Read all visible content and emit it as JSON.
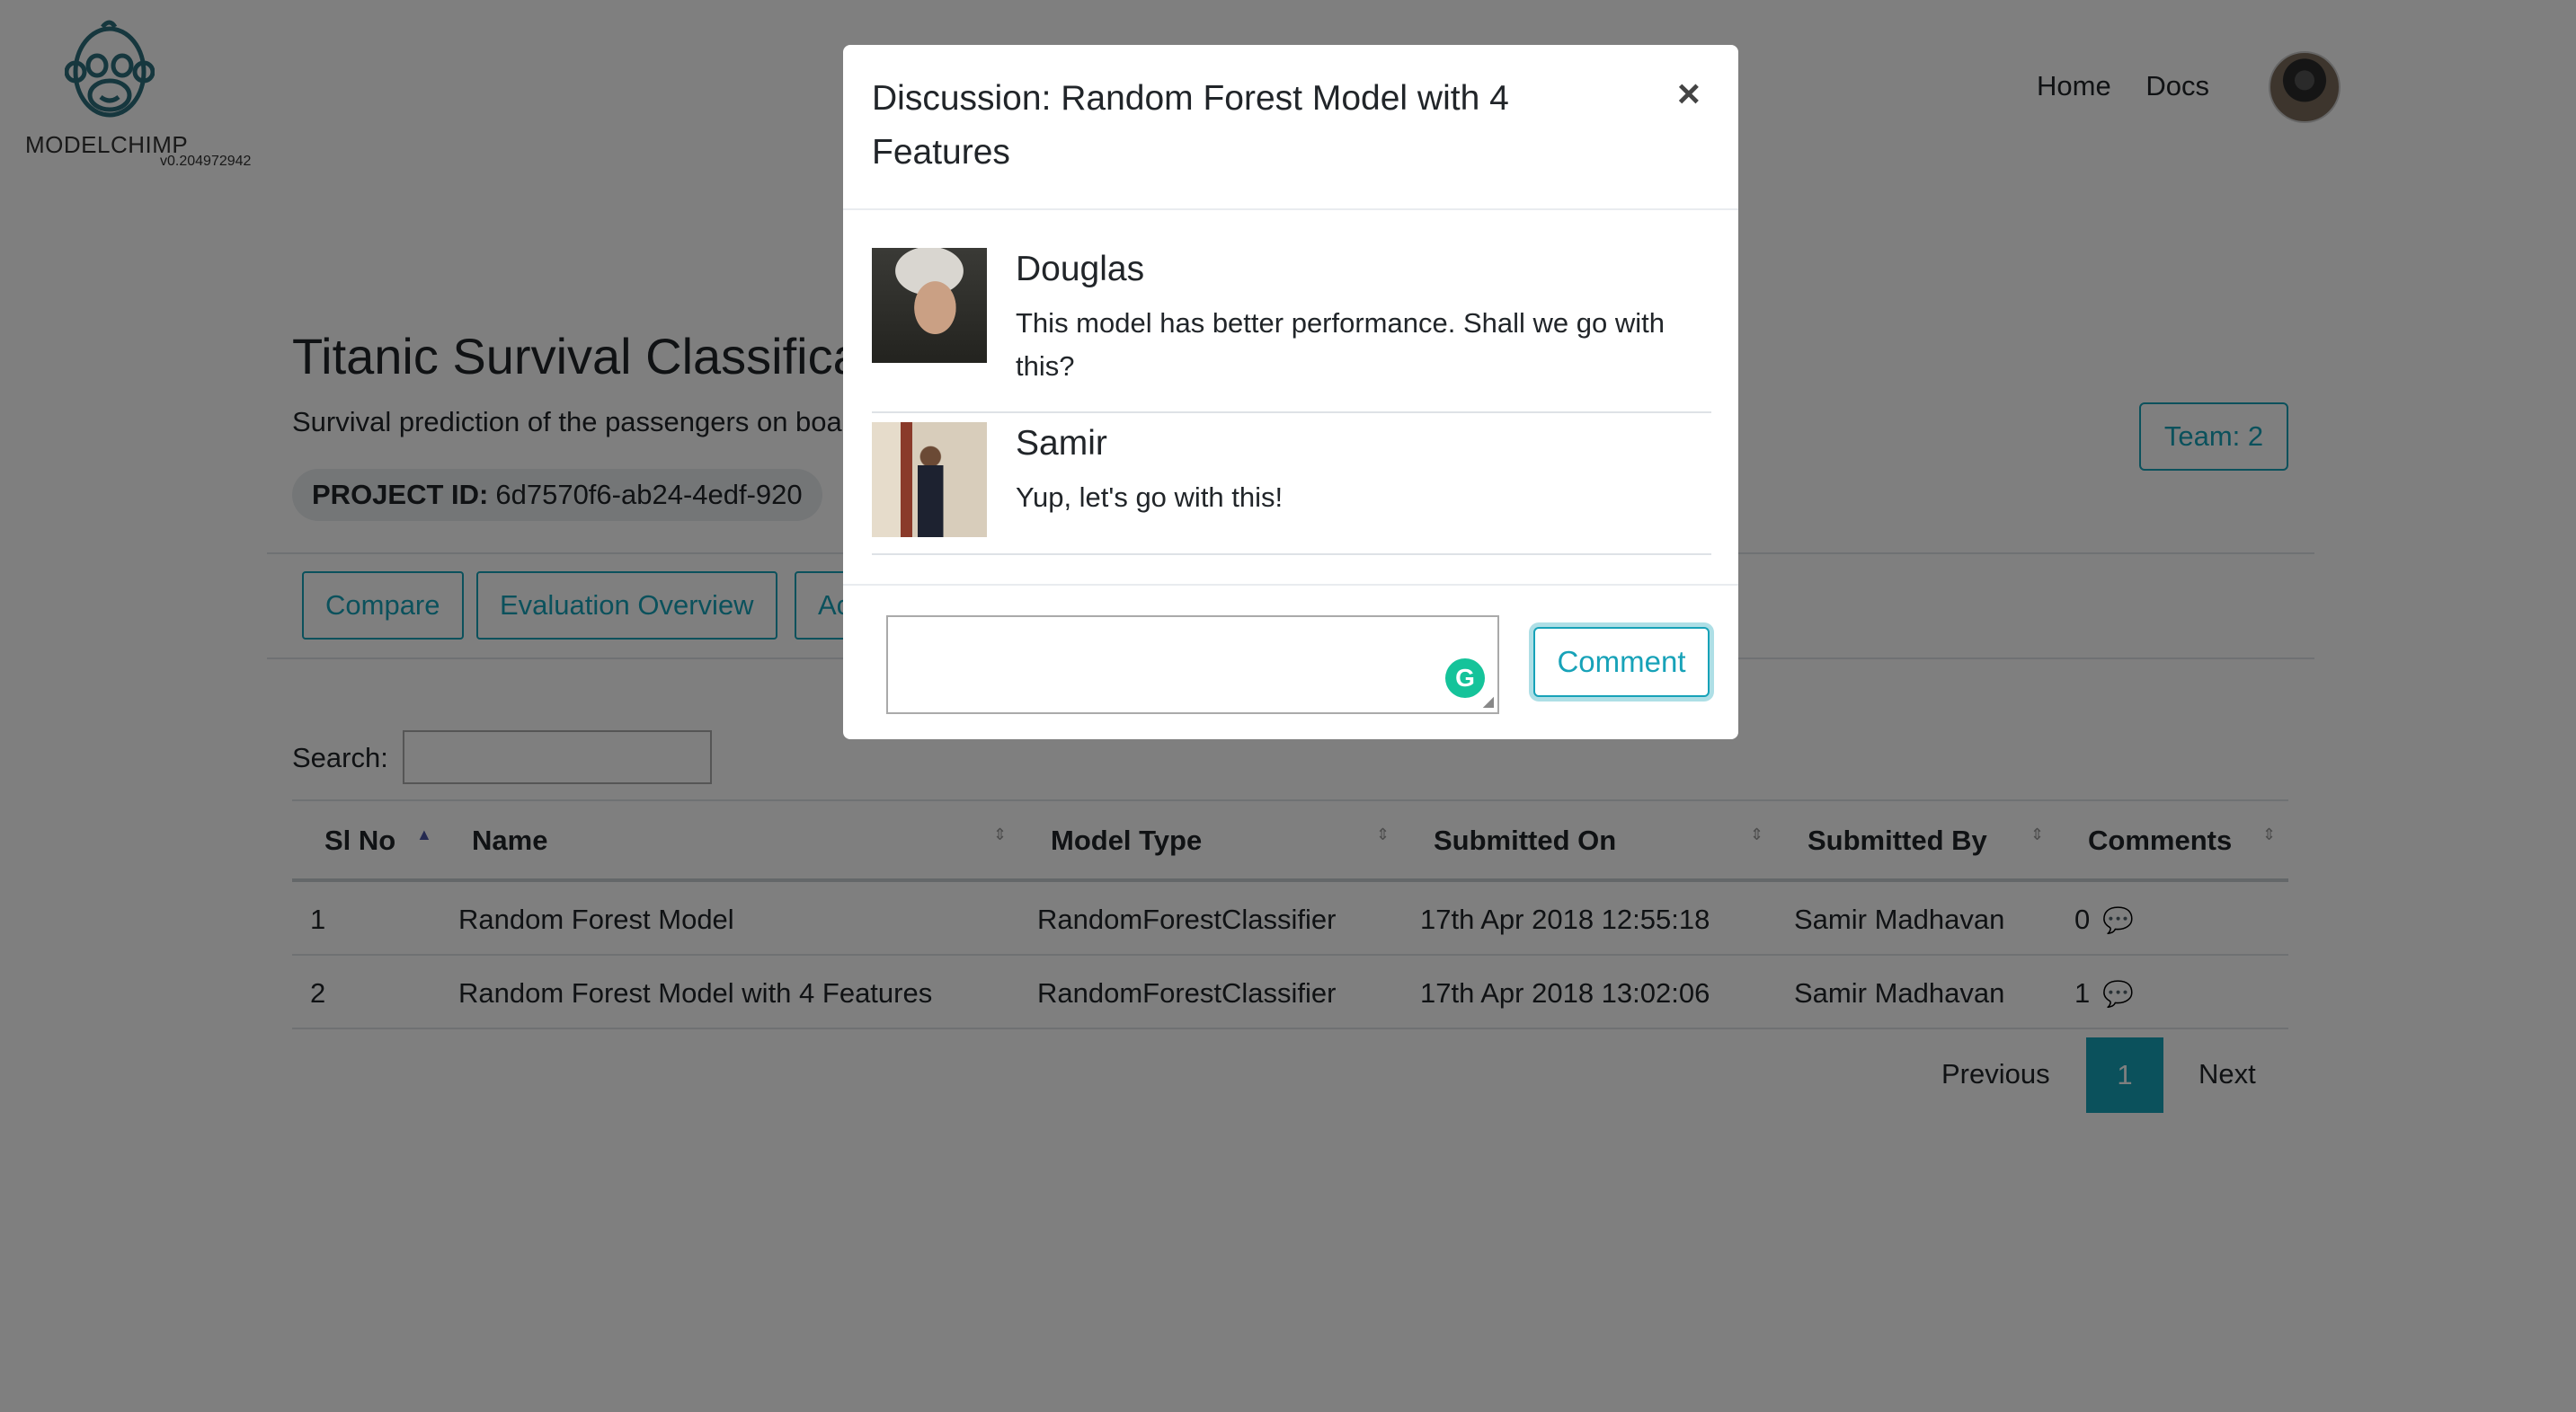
{
  "brand": {
    "name": "MODELCHIMP",
    "version": "v0.204972942"
  },
  "nav": {
    "home": "Home",
    "docs": "Docs"
  },
  "project": {
    "title": "Titanic Survival Classification",
    "description": "Survival prediction of the passengers on board",
    "id_label": "PROJECT ID:",
    "id_value": "6d7570f6-ab24-4edf-920",
    "team": "Team: 2"
  },
  "tabs": [
    "Compare",
    "Evaluation Overview",
    "Ac"
  ],
  "search": {
    "label": "Search:",
    "placeholder": ""
  },
  "table": {
    "columns": [
      "Sl No",
      "Name",
      "Model Type",
      "Submitted On",
      "Submitted By",
      "Comments"
    ],
    "rows": [
      [
        "1",
        "Random Forest Model",
        "RandomForestClassifier",
        "17th Apr 2018 12:55:18",
        "Samir Madhavan",
        "0"
      ],
      [
        "2",
        "Random Forest Model with 4 Features",
        "RandomForestClassifier",
        "17th Apr 2018 13:02:06",
        "Samir Madhavan",
        "1"
      ]
    ]
  },
  "pagination": {
    "previous": "Previous",
    "current": "1",
    "next": "Next"
  },
  "modal": {
    "title": "Discussion: Random Forest Model with 4 Features",
    "close": "×",
    "comments": [
      {
        "author": "Douglas",
        "text": "This model has better performance. Shall we go with this?"
      },
      {
        "author": "Samir",
        "text": "Yup, let's go with this!"
      }
    ],
    "input_placeholder": "",
    "submit": "Comment"
  },
  "colors": {
    "accent": "#17a2b8",
    "grammarly": "#15c39a",
    "overlay": "rgba(0,0,0,0.5)"
  }
}
